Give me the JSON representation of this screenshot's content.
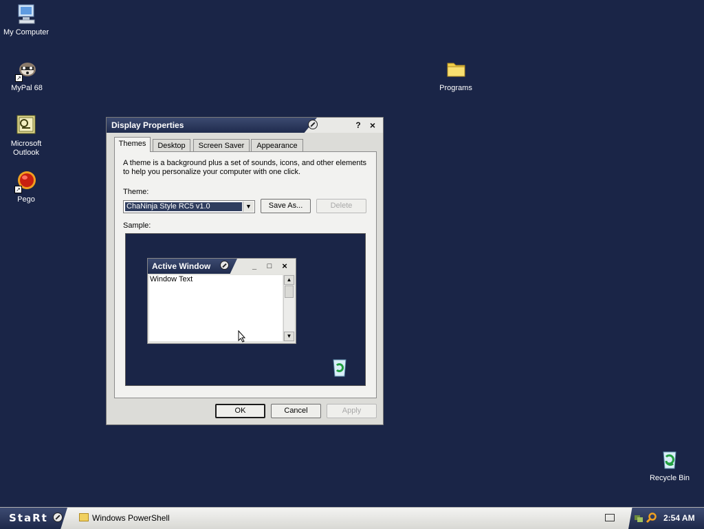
{
  "desktop": {
    "background": "#1a2547",
    "icons": [
      {
        "label": "My Computer",
        "icon": "computer-icon"
      },
      {
        "label": "MyPal 68",
        "icon": "raccoon-icon"
      },
      {
        "label": "Microsoft\nOutlook",
        "icon": "outlook-icon"
      },
      {
        "label": "Pego",
        "icon": "red-orb-icon"
      },
      {
        "label": "Programs",
        "icon": "folder-icon"
      },
      {
        "label": "Recycle Bin",
        "icon": "recycle-bin-icon"
      }
    ]
  },
  "window": {
    "title": "Display Properties",
    "help_label": "?",
    "close_label": "×",
    "tabs": [
      {
        "label": "Themes",
        "active": true
      },
      {
        "label": "Desktop",
        "active": false
      },
      {
        "label": "Screen Saver",
        "active": false
      },
      {
        "label": "Appearance",
        "active": false
      }
    ],
    "description": "A theme is a background plus a set of sounds, icons, and other elements\nto help you personalize your computer with one click.",
    "theme_label": "Theme:",
    "theme_value": "ChaNinja Style RC5 v1.0",
    "save_as_label": "Save As...",
    "delete_label": "Delete",
    "sample_label": "Sample:",
    "sample": {
      "window_title": "Active Window",
      "minimize_label": "_",
      "maximize_label": "□",
      "close_label": "×",
      "window_text": "Window Text"
    },
    "ok_label": "OK",
    "cancel_label": "Cancel",
    "apply_label": "Apply"
  },
  "taskbar": {
    "start_label": "StaRt",
    "task_label": "Windows PowerShell",
    "clock": "2:54 AM"
  }
}
